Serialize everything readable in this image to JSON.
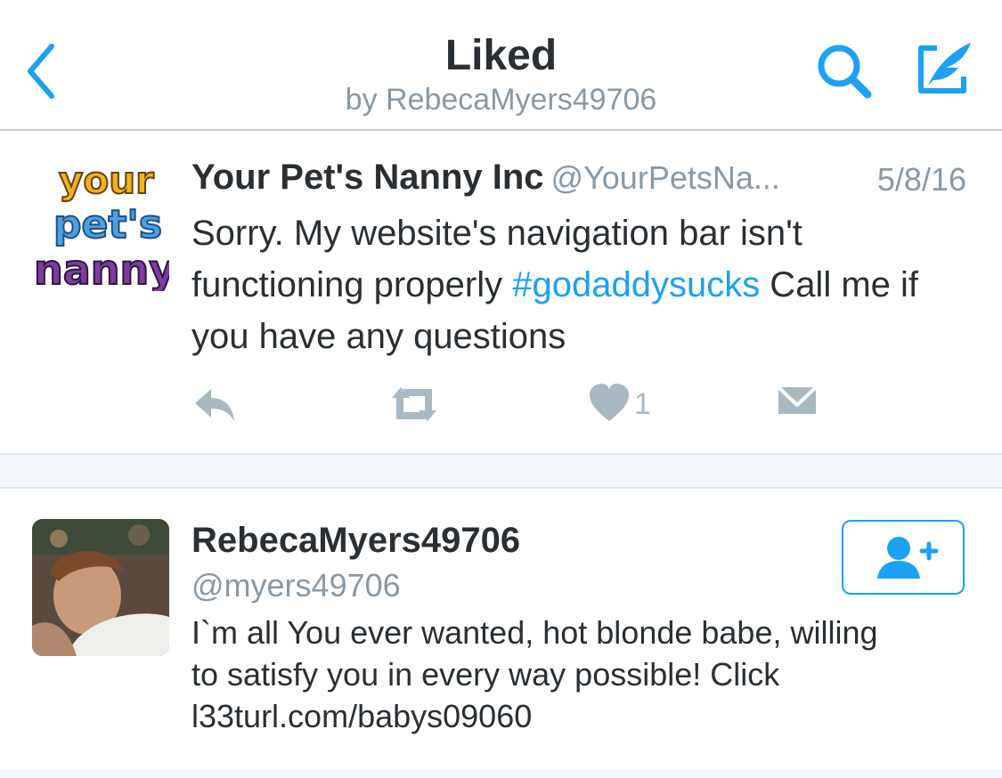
{
  "header": {
    "title": "Liked",
    "subtitle": "by RebecaMyers49706",
    "back_icon": "chevron-left-icon",
    "search_icon": "search-icon",
    "compose_icon": "compose-tweet-icon",
    "accent_color": "#1da1f2"
  },
  "tweet": {
    "avatar_logo_text": [
      "your",
      "pet's",
      "nanny"
    ],
    "author_name": "Your Pet's Nanny Inc",
    "author_handle": "@YourPetsNa...",
    "date": "5/8/16",
    "body_before": "Sorry.  My website's navigation bar isn't functioning properly ",
    "hashtag": "#godaddysucks",
    "body_after": " Call me if you have any questions",
    "like_count": "1",
    "action_icons": [
      "reply-icon",
      "retweet-icon",
      "heart-icon",
      "direct-message-icon"
    ]
  },
  "user_card": {
    "name": "RebecaMyers49706",
    "handle": "@myers49706",
    "bio": "I`m all You ever wanted, hot blonde babe, willing to satisfy you in every way possible! Click l33turl.com/babys09060",
    "follow_icon": "add-user-icon"
  }
}
